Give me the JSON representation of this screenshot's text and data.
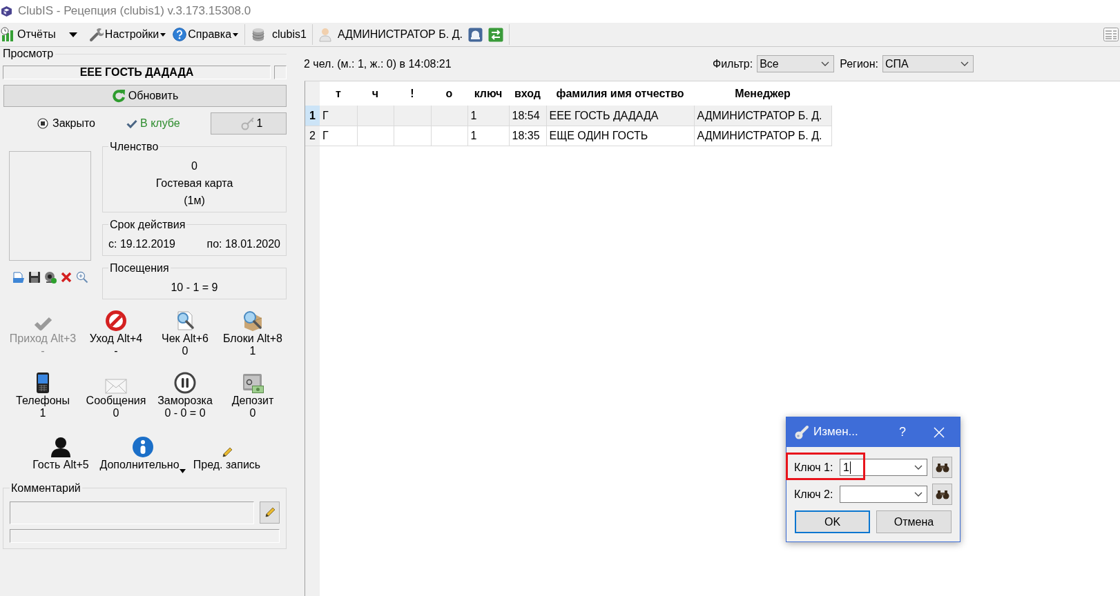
{
  "window": {
    "title": "ClubIS - Рецепция (clubis1) v.3.173.15308.0"
  },
  "toolbar": {
    "menus": [
      {
        "label": "Отчёты",
        "split_arrow": true,
        "has_menu": false
      },
      {
        "label": "Настройки",
        "split_arrow": false,
        "has_menu": true
      },
      {
        "label": "Справка",
        "split_arrow": false,
        "has_menu": true
      }
    ],
    "database": "clubis1",
    "user": "АДМИНИСТРАТОР Б. Д."
  },
  "view": {
    "title": "Просмотр",
    "name": "ЕЕЕ ГОСТЬ ДАДАДА",
    "refresh_button": "Обновить",
    "closed": {
      "label": "Закрыто",
      "selected": true
    },
    "in_club": {
      "label": "В клубе",
      "checked": true
    },
    "key_button": "1",
    "membership": {
      "title": "Членство",
      "lines": [
        "0",
        "Гостевая карта",
        "(1м)"
      ]
    },
    "validity": {
      "title": "Срок действия",
      "from": "с: 19.12.2019",
      "to": "по: 18.01.2020"
    },
    "visits": {
      "title": "Посещения",
      "value": "10 - 1 = 9"
    },
    "actions": [
      {
        "label": "Приход Alt+3",
        "value": "-",
        "disabled": true,
        "has_menu": false
      },
      {
        "label": "Уход Alt+4",
        "value": "-",
        "disabled": false,
        "has_menu": false
      },
      {
        "label": "Чек Alt+6",
        "value": "0",
        "disabled": false,
        "has_menu": false
      },
      {
        "label": "Блоки Alt+8",
        "value": "1",
        "disabled": false,
        "has_menu": false
      },
      {
        "label": "Телефоны",
        "value": "1",
        "disabled": false,
        "has_menu": false
      },
      {
        "label": "Сообщения",
        "value": "0",
        "disabled": false,
        "has_menu": false
      },
      {
        "label": "Заморозка",
        "value": "0 - 0 = 0",
        "disabled": false,
        "has_menu": false
      },
      {
        "label": "Депозит",
        "value": "0",
        "disabled": false,
        "has_menu": false
      },
      {
        "label": "Гость Alt+5",
        "disabled": false,
        "has_menu": false
      },
      {
        "label": "Дополнительно",
        "disabled": false,
        "has_menu": true
      },
      {
        "label": "Пред. запись",
        "disabled": false,
        "has_menu": false
      }
    ],
    "comment": {
      "title": "Комментарий"
    }
  },
  "summary": "2 чел. (м.: 1, ж.: 0) в 14:08:21",
  "filters": [
    {
      "label": "Фильтр:",
      "value": "Все"
    },
    {
      "label": "Регион:",
      "value": "СПА"
    }
  ],
  "table": {
    "columns": [
      "т",
      "ч",
      "!",
      "о",
      "ключ",
      "вход",
      "фамилия имя отчество",
      "Менеджер"
    ],
    "rows": [
      {
        "number": "1",
        "selected": true,
        "cells": [
          "Г",
          null,
          null,
          null,
          "1",
          "18:54",
          "ЕЕЕ ГОСТЬ ДАДАДА",
          "АДМИНИСТРАТОР Б. Д."
        ]
      },
      {
        "number": "2",
        "selected": false,
        "cells": [
          "Г",
          null,
          null,
          null,
          "1",
          "18:35",
          "ЕЩЕ ОДИН ГОСТЬ",
          "АДМИНИСТРАТОР Б. Д."
        ]
      }
    ]
  },
  "dialog": {
    "title": "Измен...",
    "help": "?",
    "fields": [
      {
        "label": "Ключ 1:",
        "value": "1",
        "focused": true,
        "highlighted": true
      },
      {
        "label": "Ключ 2:",
        "focused": false,
        "highlighted": false
      }
    ],
    "buttons": [
      {
        "label": "OK",
        "default": true
      },
      {
        "label": "Отмена",
        "default": false
      }
    ]
  }
}
